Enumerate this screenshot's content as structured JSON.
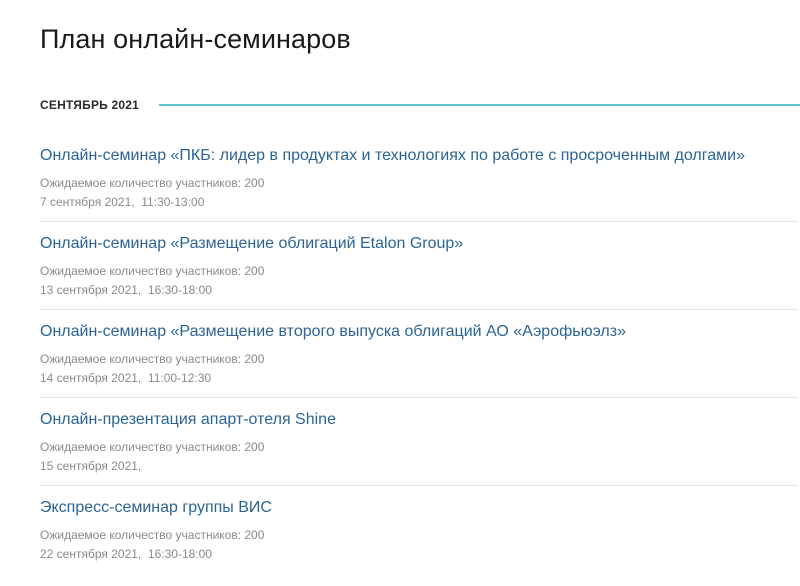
{
  "page": {
    "title": "План онлайн-семинаров"
  },
  "section": {
    "label": "СЕНТЯБРЬ 2021",
    "accent_color": "#5bc4cf"
  },
  "colors": {
    "link": "#2a6496",
    "meta_text": "#8a8a8a",
    "divider": "#e3e3e3"
  },
  "events": [
    {
      "title": "Онлайн-семинар «ПКБ: лидер в продуктах и технологиях по работе с просроченным долгами»",
      "participants": "Ожидаемое количество участников: 200",
      "date": "7 сентября 2021,  11:30-13:00"
    },
    {
      "title": "Онлайн-семинар «Размещение облигаций Etalon Group»",
      "participants": "Ожидаемое количество участников: 200",
      "date": "13 сентября 2021,  16:30-18:00"
    },
    {
      "title": "Онлайн-семинар «Размещение второго выпуска облигаций АО «Аэрофьюэлз»",
      "participants": "Ожидаемое количество участников: 200",
      "date": "14 сентября 2021,  11:00-12:30"
    },
    {
      "title": "Онлайн-презентация апарт-отеля Shine",
      "participants": "Ожидаемое количество участников: 200",
      "date": "15 сентября 2021,"
    },
    {
      "title": "Экспресс-семинар группы ВИС",
      "participants": "Ожидаемое количество участников: 200",
      "date": "22 сентября 2021,  16:30-18:00"
    }
  ]
}
